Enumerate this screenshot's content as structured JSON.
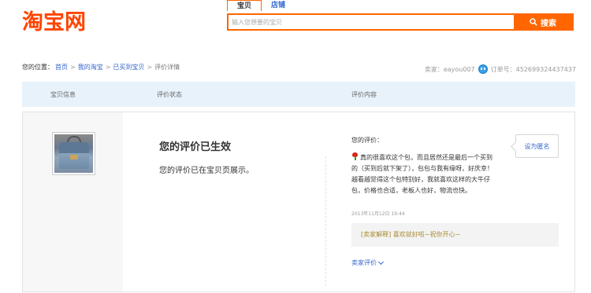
{
  "header": {
    "logo_text": "淘宝网",
    "search_tabs": [
      "宝贝",
      "店铺"
    ],
    "search_placeholder": "输入您想要的宝贝",
    "search_button": "搜索",
    "brand_color": "#ff4400",
    "accent_color": "#ff6600"
  },
  "breadcrumb": {
    "prefix": "您的位置：",
    "items": [
      "首页",
      "我的淘宝",
      "已买到宝贝"
    ],
    "current": "评价详情",
    "separator": ">"
  },
  "seller": {
    "label": "卖家：eayou007",
    "order_label": "订单号：452699324437437"
  },
  "table_header": {
    "col_item": "宝贝信息",
    "col_status": "评价状态",
    "col_content": "评价内容"
  },
  "review": {
    "status_title": "您的评价已生效",
    "status_desc": "您的评价已在宝贝页展示。",
    "label": "您的评价：",
    "text": "真的很喜欢这个包，而且居然还是最后一个买到的（买到后就下架了），包包与我有缘呀，好庆幸！越看越觉得这个包特别好，我就喜欢这样的大牛仔包，价格也合适，老板人也好，物流也快。",
    "time": "2013年11月12日 19:44",
    "reply_tag": "[卖家解释]",
    "reply_text": "喜欢就好啦~祝你开心~",
    "seller_review_link": "卖家评价",
    "anon_button": "设为匿名"
  }
}
